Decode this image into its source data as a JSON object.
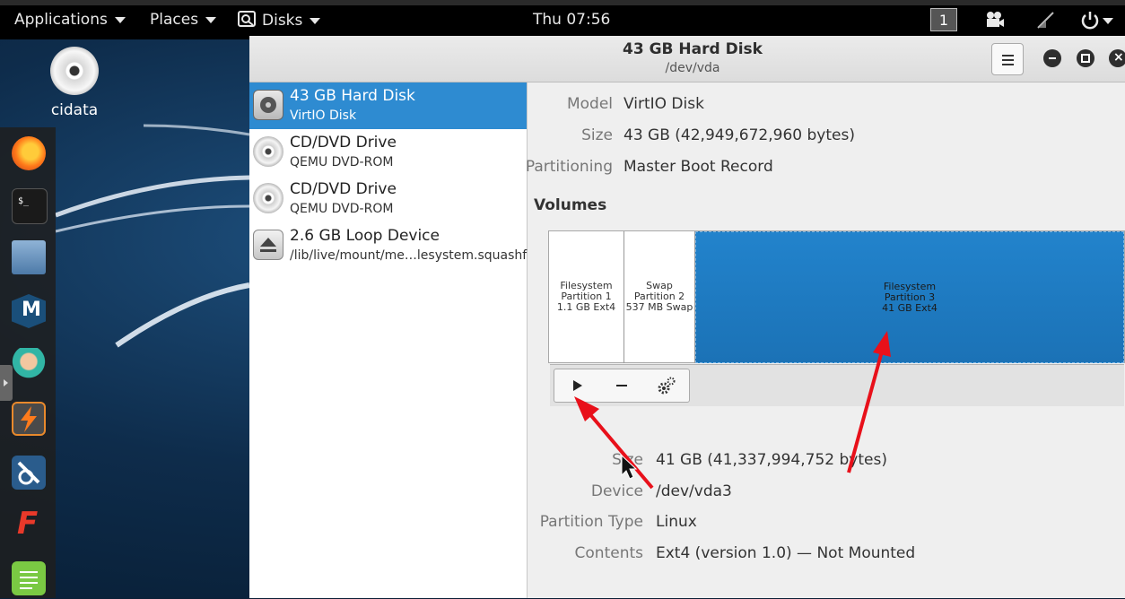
{
  "topbar": {
    "applications": "Applications",
    "places": "Places",
    "disks": "Disks",
    "clock": "Thu 07:56",
    "workspace": "1"
  },
  "desktop": {
    "icon_label": "cidata"
  },
  "dock": {
    "icons": [
      "firefox-icon",
      "terminal-icon",
      "files-icon",
      "metasploit-icon",
      "armitage-icon",
      "burpsuite-icon",
      "maltego-icon",
      "faraday-icon",
      "leafpad-icon"
    ]
  },
  "window": {
    "title": "43 GB Hard Disk",
    "subtitle": "/dev/vda"
  },
  "devices": [
    {
      "name": "43 GB Hard Disk",
      "sub": "VirtIO Disk"
    },
    {
      "name": "CD/DVD Drive",
      "sub": "QEMU DVD-ROM"
    },
    {
      "name": "CD/DVD Drive",
      "sub": "QEMU DVD-ROM"
    },
    {
      "name": "2.6 GB Loop Device",
      "sub": "/lib/live/mount/me…lesystem.squashfs"
    }
  ],
  "disk_info": {
    "model_label": "Model",
    "model": "VirtIO Disk",
    "size_label": "Size",
    "size": "43 GB (42,949,672,960 bytes)",
    "partitioning_label": "Partitioning",
    "partitioning": "Master Boot Record"
  },
  "volumes_heading": "Volumes",
  "partitions": [
    {
      "line1": "Filesystem",
      "line2": "Partition 1",
      "line3": "1.1 GB Ext4"
    },
    {
      "line1": "Swap",
      "line2": "Partition 2",
      "line3": "537 MB Swap"
    },
    {
      "line1": "Filesystem",
      "line2": "Partition 3",
      "line3": "41 GB Ext4"
    }
  ],
  "partition_info": {
    "size_label": "Size",
    "size": "41 GB (41,337,994,752 bytes)",
    "device_label": "Device",
    "device": "/dev/vda3",
    "type_label": "Partition Type",
    "type": "Linux",
    "contents_label": "Contents",
    "contents": "Ext4 (version 1.0) — Not Mounted"
  },
  "colors": {
    "selection": "#2e8bd1",
    "partition_selected": "#1f78c0",
    "annotation": "#e8101a"
  }
}
